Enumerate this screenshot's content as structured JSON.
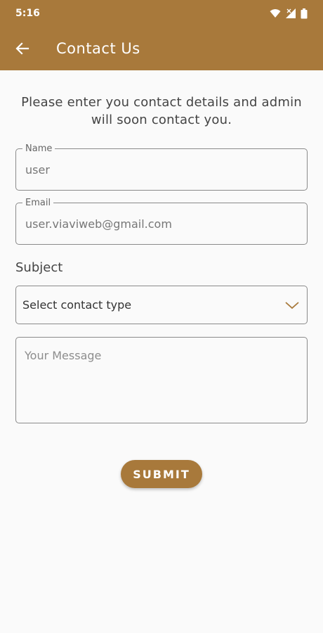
{
  "status_bar": {
    "time": "5:16",
    "icons": [
      "wifi-icon",
      "signal-icon",
      "battery-icon"
    ]
  },
  "app_bar": {
    "title": "Contact Us",
    "back_icon": "arrow-left-icon",
    "color": "#a8793b"
  },
  "form": {
    "intro": "Please enter you contact details and admin will soon contact you.",
    "name": {
      "label": "Name",
      "value": "user"
    },
    "email": {
      "label": "Email",
      "value": "user.viaviweb@gmail.com"
    },
    "subject": {
      "label": "Subject",
      "selected": "Select contact type",
      "icon": "chevron-down-icon"
    },
    "message": {
      "placeholder": "Your Message",
      "value": ""
    },
    "submit_label": "SUBMIT"
  }
}
